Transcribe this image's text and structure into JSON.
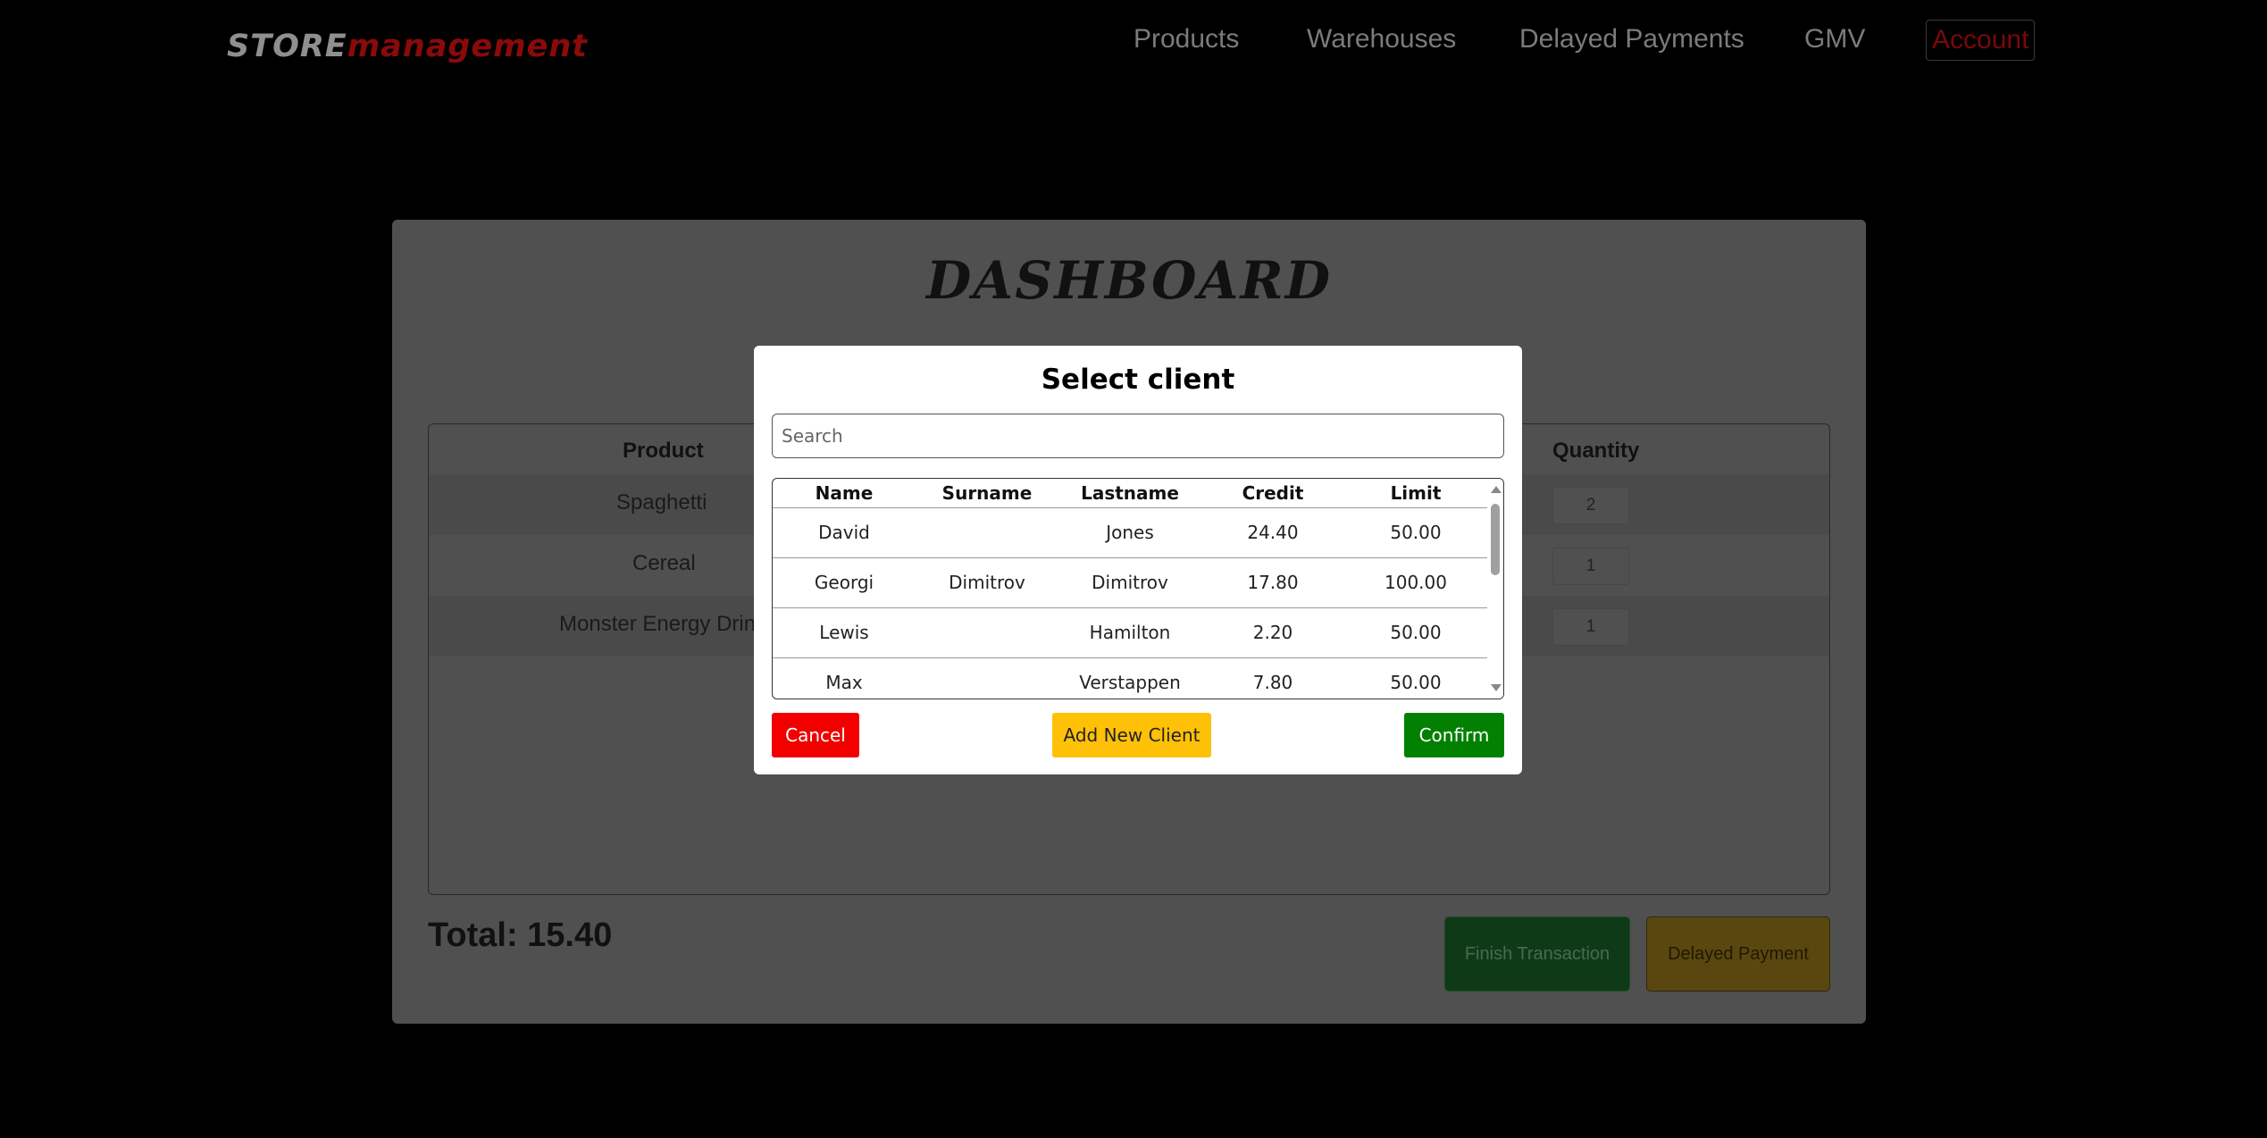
{
  "nav": {
    "logo_part1": "STORE",
    "logo_part2": "management",
    "items": [
      "Products",
      "Warehouses",
      "Delayed Payments",
      "GMV",
      "Account"
    ]
  },
  "dashboard": {
    "title": "DASHBOARD",
    "headers": {
      "product": "Product",
      "quantity": "Quantity"
    },
    "rows": [
      {
        "product": "Spaghetti",
        "quantity": "2"
      },
      {
        "product": "Cereal",
        "quantity": "1"
      },
      {
        "product": "Monster Energy Drin",
        "quantity": "1"
      }
    ],
    "total": "Total: 15.40",
    "finish_label": "Finish Transaction",
    "delayed_label": "Delayed Payment"
  },
  "modal": {
    "title": "Select client",
    "search_placeholder": "Search",
    "columns": [
      "Name",
      "Surname",
      "Lastname",
      "Credit",
      "Limit"
    ],
    "clients": [
      [
        "David",
        "",
        "Jones",
        "24.40",
        "50.00"
      ],
      [
        "Georgi",
        "Dimitrov",
        "Dimitrov",
        "17.80",
        "100.00"
      ],
      [
        "Lewis",
        "",
        "Hamilton",
        "2.20",
        "50.00"
      ],
      [
        "Max",
        "",
        "Verstappen",
        "7.80",
        "50.00"
      ]
    ],
    "cancel_label": "Cancel",
    "add_label": "Add New Client",
    "confirm_label": "Confirm"
  },
  "colors": {
    "cancel": "#f20000",
    "add": "#ffc107",
    "confirm": "#028002"
  }
}
